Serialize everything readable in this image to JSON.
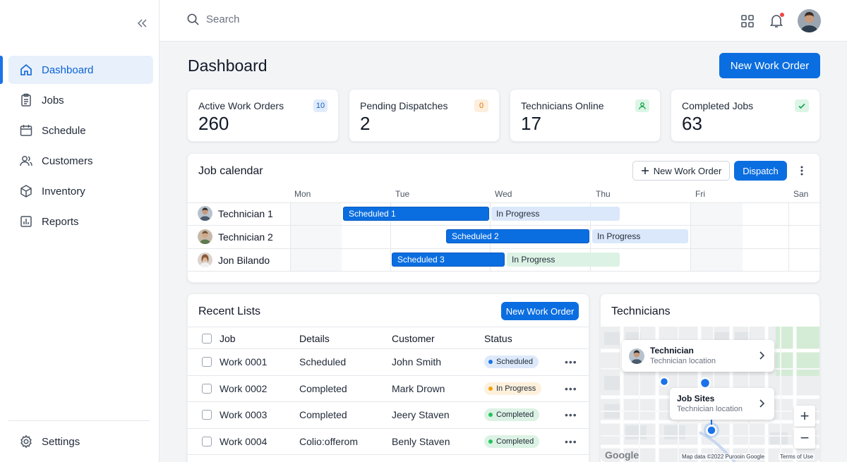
{
  "search": {
    "placeholder": "Search"
  },
  "sidebar": {
    "items": [
      {
        "label": "Dashboard",
        "icon": "home-icon"
      },
      {
        "label": "Jobs",
        "icon": "clipboard-icon"
      },
      {
        "label": "Schedule",
        "icon": "calendar-icon"
      },
      {
        "label": "Customers",
        "icon": "users-icon"
      },
      {
        "label": "Inventory",
        "icon": "box-icon"
      },
      {
        "label": "Reports",
        "icon": "report-icon"
      }
    ],
    "settings_label": "Settings"
  },
  "page": {
    "title": "Dashboard",
    "new_work_order_label": "New Work Order"
  },
  "stats": [
    {
      "label": "Active Work Orders",
      "value": "260",
      "badge": "10"
    },
    {
      "label": "Pending Dispatches",
      "value": "2",
      "badge": "0"
    },
    {
      "label": "Technicians Online",
      "value": "17",
      "badge_icon": "user-icon"
    },
    {
      "label": "Completed Jobs",
      "value": "63",
      "badge_icon": "check-icon"
    }
  ],
  "calendar": {
    "title": "Job calendar",
    "new_work_order_label": "New Work Order",
    "dispatch_label": "Dispatch",
    "days": [
      "Mon",
      "Tue",
      "Wed",
      "Thu",
      "Fri",
      "San"
    ],
    "rows": [
      {
        "technician": "Technician 1",
        "scheduled": "Scheduled 1",
        "progress": "In Progress"
      },
      {
        "technician": "Technician 2",
        "scheduled": "Scheduled 2",
        "progress": "In Progress"
      },
      {
        "technician": "Jon Bilando",
        "scheduled": "Scheduled 3",
        "progress": "In Progress"
      }
    ]
  },
  "recent": {
    "title": "Recent Lists",
    "new_work_order_label": "New Work Order",
    "headers": [
      "Job",
      "Details",
      "Customer",
      "Status"
    ],
    "rows": [
      {
        "job": "Work 0001",
        "details": "Scheduled",
        "customer": "John Smith",
        "status": "Scheduled"
      },
      {
        "job": "Work 0002",
        "details": "Completed",
        "customer": "Mark Drown",
        "status": "In Progress"
      },
      {
        "job": "Work 0003",
        "details": "Completed",
        "customer": "Jeery Staven",
        "status": "Completed"
      },
      {
        "job": "Work 0004",
        "details": "Colio:offerom",
        "customer": "Benly Staven",
        "status": "Completed"
      }
    ]
  },
  "technicians": {
    "title": "Technicians",
    "popup1": {
      "title": "Technician",
      "subtitle": "Technician location"
    },
    "popup2": {
      "title": "Job Sites",
      "subtitle": "Technician location"
    },
    "zoom_in": "+",
    "zoom_out": "−",
    "map_logo": "Google",
    "map_attribution": "Map data ©2022 Purooin Google",
    "map_terms": "Terms of Use"
  },
  "colors": {
    "accent": "#0b6ee0",
    "scheduled_dot": "#1a73e8",
    "in_progress_dot": "#f59e0b",
    "completed_dot": "#22c55e",
    "notification_dot": "#ef4444"
  }
}
